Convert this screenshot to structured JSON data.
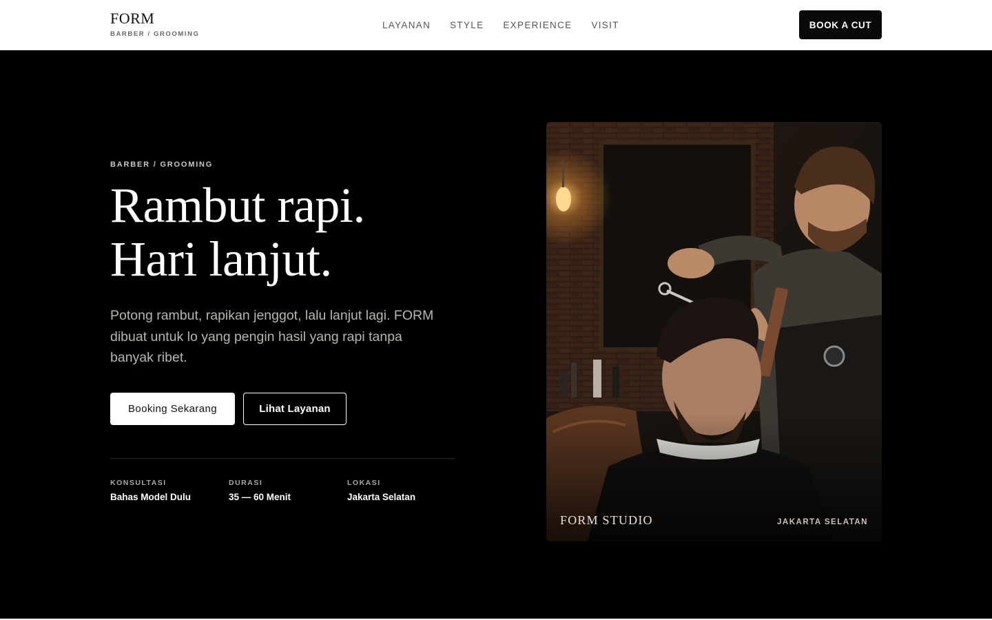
{
  "header": {
    "brand_name": "FORM",
    "brand_tagline": "BARBER / GROOMING",
    "nav": [
      "LAYANAN",
      "STYLE",
      "EXPERIENCE",
      "VISIT"
    ],
    "cta_label": "BOOK A CUT"
  },
  "hero": {
    "eyebrow": "BARBER / GROOMING",
    "headline_line1": "Rambut rapi.",
    "headline_line2": "Hari lanjut.",
    "lede": "Potong rambut, rapikan jenggot, lalu lanjut lagi. FORM dibuat untuk lo yang pengin hasil yang rapi tanpa banyak ribet.",
    "primary_button": "Booking Sekarang",
    "secondary_button": "Lihat Layanan",
    "facts": [
      {
        "label": "KONSULTASI",
        "value": "Bahas Model Dulu"
      },
      {
        "label": "DURASI",
        "value": "35 — 60 Menit"
      },
      {
        "label": "LOKASI",
        "value": "Jakarta Selatan"
      }
    ]
  },
  "photo": {
    "caption": "FORM STUDIO",
    "location": "JAKARTA SELATAN"
  },
  "colors": {
    "background": "#000000",
    "header_background": "#ffffff",
    "accent_text": "#b9b6b0"
  }
}
